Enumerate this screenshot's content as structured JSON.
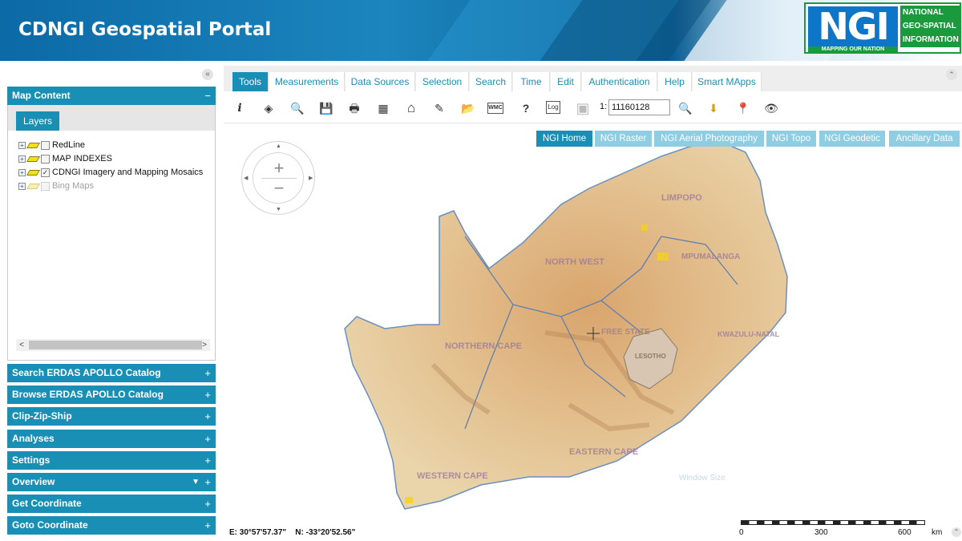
{
  "header": {
    "title": "CDNGI Geospatial Portal"
  },
  "logo": {
    "mark": "NGI",
    "line1": "NATIONAL",
    "line2": "GEO-SPATIAL",
    "line3": "INFORMATION",
    "motto": "MAPPING OUR NATION"
  },
  "sidebar": {
    "collapse_icon": "«",
    "map_content": {
      "title": "Map Content",
      "toggle": "−",
      "layers_tab": "Layers",
      "layers": [
        {
          "label": "RedLine",
          "checked": ""
        },
        {
          "label": "MAP INDEXES",
          "checked": ""
        },
        {
          "label": "CDNGI Imagery and Mapping Mosaics",
          "checked": "✓"
        },
        {
          "label": "Bing Maps",
          "checked": ""
        }
      ],
      "scroll_left": "<",
      "scroll_right": ">"
    },
    "panels": [
      {
        "title": "Search ERDAS APOLLO Catalog",
        "toggle": "+"
      },
      {
        "title": "Browse ERDAS APOLLO Catalog",
        "toggle": "+"
      },
      {
        "title": "Clip-Zip-Ship",
        "toggle": "+"
      },
      {
        "title": "Analyses",
        "toggle": "+"
      },
      {
        "title": "Settings",
        "toggle": "+"
      },
      {
        "title": "Overview",
        "toggle": "+",
        "dropdown": "▼"
      },
      {
        "title": "Get Coordinate",
        "toggle": "+"
      },
      {
        "title": "Goto Coordinate",
        "toggle": "+"
      }
    ]
  },
  "tabs": [
    "Tools",
    "Measurements",
    "Data Sources",
    "Selection",
    "Search",
    "Time",
    "Edit",
    "Authentication",
    "Help",
    "Smart MApps"
  ],
  "active_tab": "Tools",
  "toolbar": {
    "tools": [
      {
        "name": "info-icon",
        "glyph": "i"
      },
      {
        "name": "identify-icon",
        "glyph": "◈"
      },
      {
        "name": "zoom-extent-icon",
        "glyph": "🔍"
      },
      {
        "name": "save-icon",
        "glyph": "💾"
      },
      {
        "name": "print-icon",
        "glyph": "🖶"
      },
      {
        "name": "table-icon",
        "glyph": "▦"
      },
      {
        "name": "home-icon",
        "glyph": "⌂"
      },
      {
        "name": "pen-icon",
        "glyph": "✎"
      },
      {
        "name": "folder-icon",
        "glyph": "📂"
      },
      {
        "name": "wmc-icon",
        "glyph": "WMC"
      },
      {
        "name": "help-icon",
        "glyph": "?"
      },
      {
        "name": "log-icon",
        "glyph": "Log"
      },
      {
        "name": "cube-icon",
        "glyph": "▣"
      }
    ],
    "scale_label": "1:",
    "scale_value": "11160128",
    "tools_right": [
      {
        "name": "zoom-scale-icon",
        "glyph": "🔍"
      },
      {
        "name": "marker-icon",
        "glyph": "⬇"
      },
      {
        "name": "pin-icon",
        "glyph": "📍"
      },
      {
        "name": "eye-icon",
        "glyph": "👁"
      }
    ]
  },
  "map_tabs": [
    "NGI Home",
    "NGI Raster",
    "NGI Aerial Photography",
    "NGI Topo",
    "NGI Geodetic",
    "Ancillary Data"
  ],
  "active_map_tab": "NGI Home",
  "map_labels": {
    "limpopo": "LIMPOPO",
    "north_west": "NORTH WEST",
    "mpumalanga": "MPUMALANGA",
    "free_state": "FREE STATE",
    "kwazulu_natal": "KWAZULU-NATAL",
    "lesotho": "LESOTHO",
    "northern_cape": "NORTHERN CAPE",
    "eastern_cape": "EASTERN CAPE",
    "western_cape": "WESTERN CAPE",
    "window_size": "Window Size"
  },
  "nav": {
    "zoom_in": "+",
    "zoom_out": "−",
    "up": "▲",
    "down": "▼",
    "left": "◀",
    "right": "▶"
  },
  "coordinates": {
    "easting": "E: 30°57'57.37\"",
    "northing": "N: -33°20'52.56\""
  },
  "scalebar": {
    "labels": [
      "0",
      "300",
      "600",
      "km"
    ]
  },
  "colors": {
    "accent": "#1a8fb5",
    "header": "#0c6aa6",
    "logo_green": "#1a9a3c",
    "logo_blue": "#0e76c8"
  }
}
